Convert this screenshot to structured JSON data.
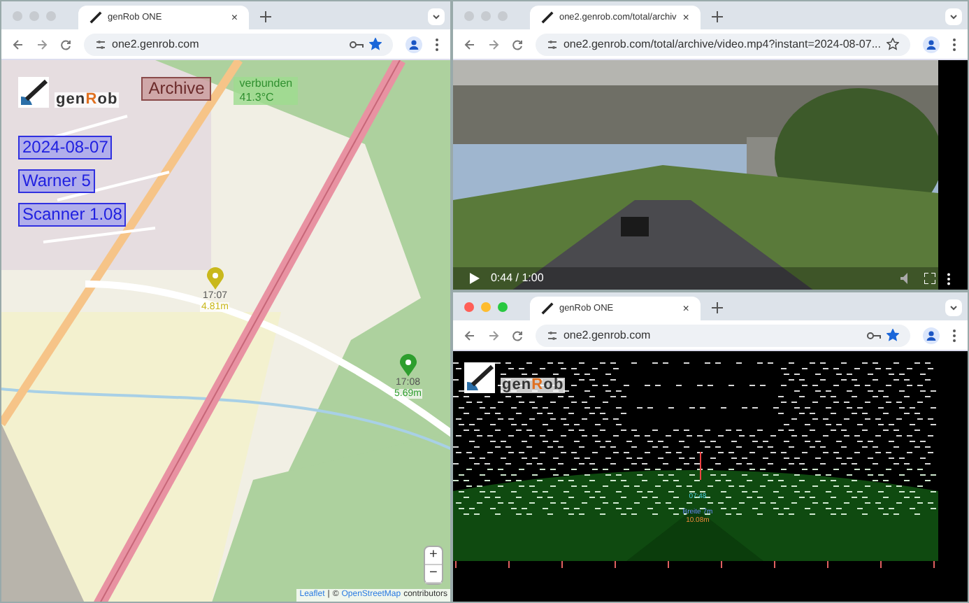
{
  "windows": [
    {
      "kind": "map",
      "active": false,
      "tab": {
        "title": "genRob ONE",
        "close": "×"
      },
      "url": "one2.genrob.com",
      "key_icon": true,
      "bookmarked": true,
      "map": {
        "logo": [
          {
            "text": "gen",
            "color": "#333333"
          },
          {
            "text": "R",
            "color": "#e07020"
          },
          {
            "text": "ob",
            "color": "#333333"
          }
        ],
        "archive_button": "Archive",
        "status": "verbunden",
        "temperature": "41.3°C",
        "info": [
          "2024-08-07",
          "Warner 5",
          "Scanner 1.08"
        ],
        "markers": [
          {
            "time": "17:07",
            "distance": "4.81m",
            "color": "#c9b81c"
          },
          {
            "time": "17:08",
            "distance": "5.69m",
            "color": "#2e9e2e"
          }
        ],
        "zoom": [
          "+",
          "−"
        ],
        "attribution": [
          "Leaflet",
          "|",
          "©",
          "OpenStreetMap",
          "contributors"
        ]
      }
    },
    {
      "kind": "video",
      "active": false,
      "tab": {
        "title": "one2.genrob.com/total/archiv",
        "close": "×"
      },
      "url": "one2.genrob.com/total/archive/video.mp4?instant=2024-08-07...",
      "key_icon": false,
      "bookmarked": false,
      "video": {
        "playing": false,
        "time": "0:44 / 1:00"
      }
    },
    {
      "kind": "scan",
      "active": true,
      "tab": {
        "title": "genRob ONE",
        "close": "×"
      },
      "url": "one2.genrob.com",
      "key_icon": true,
      "bookmarked": true,
      "scan": {
        "logo": [
          {
            "text": "gen",
            "color": "#333333"
          },
          {
            "text": "R",
            "color": "#e07020"
          },
          {
            "text": "ob",
            "color": "#333333"
          }
        ],
        "time": "07:48",
        "width_label": "Breite 7m",
        "distance": "10.08m"
      }
    }
  ]
}
